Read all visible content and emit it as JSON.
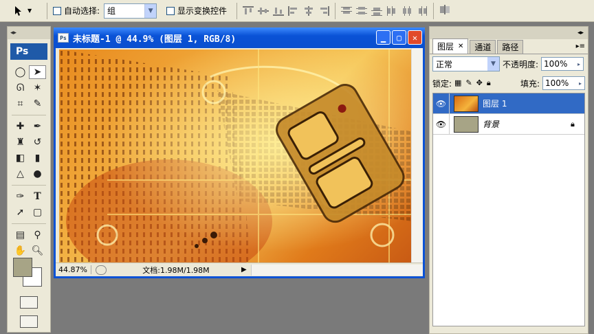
{
  "options_bar": {
    "auto_select_label": "自动选择:",
    "group_value": "组",
    "show_transform_label": "显示变换控件"
  },
  "toolbox": {
    "logo": "Ps",
    "colors": {
      "foreground": "#a7a486",
      "background": "#ffffff"
    }
  },
  "document": {
    "title": "未标题-1 @ 44.9% (图层 1, RGB/8)",
    "zoom": "44.87%",
    "doc_info": "文档:1.98M/1.98M"
  },
  "layers_panel": {
    "tabs": [
      "图层",
      "通道",
      "路径"
    ],
    "blend_mode": "正常",
    "opacity_label": "不透明度:",
    "opacity_value": "100%",
    "lock_label": "锁定:",
    "fill_label": "填充:",
    "fill_value": "100%",
    "layers": [
      {
        "name": "图层 1",
        "selected": true
      },
      {
        "name": "背景",
        "locked": true
      }
    ]
  }
}
